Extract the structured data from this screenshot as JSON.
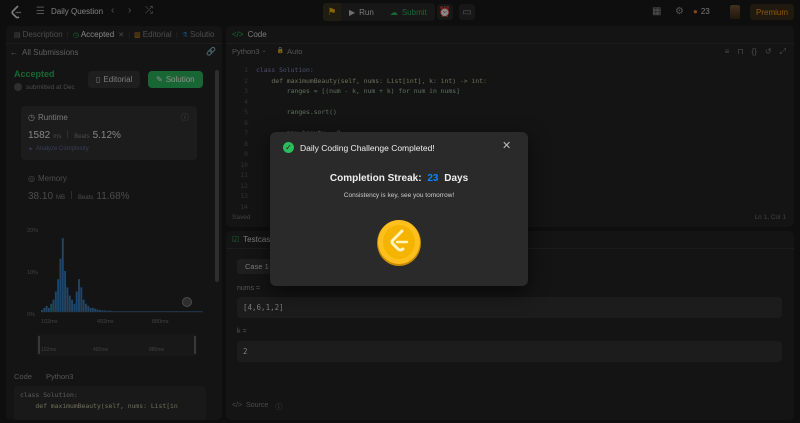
{
  "topbar": {
    "title": "Daily Question",
    "run_label": "Run",
    "submit_label": "Submit",
    "streak_count": "23",
    "premium_label": "Premium"
  },
  "left": {
    "tabs": [
      "Description",
      "Accepted",
      "Editorial",
      "Solutio"
    ],
    "back_label": "All Submissions",
    "status": "Accepted",
    "submitted": "submitted at Dec",
    "editorial_btn": "Editorial",
    "solution_btn": "Solution",
    "runtime": {
      "label": "Runtime",
      "value": "1582",
      "unit": "ms",
      "beats_label": "Beats",
      "beats": "5.12%",
      "analyze": "Analyze Complexity"
    },
    "memory": {
      "label": "Memory",
      "value": "38.10",
      "unit": "MB",
      "beats_label": "Beats",
      "beats": "11.68%"
    },
    "chart_data": {
      "type": "bar",
      "y_ticks": [
        "20%",
        "10%",
        "0%"
      ],
      "x_ticks": [
        "102ms",
        "492ms",
        "880ms"
      ],
      "mini_x_ticks": [
        "102ms",
        "492ms",
        "880ms"
      ],
      "ylim": [
        0,
        20
      ],
      "values": [
        0.5,
        1,
        1.5,
        1,
        2,
        3,
        5,
        8,
        13,
        18,
        10,
        6,
        4,
        3,
        2,
        5,
        8,
        6,
        3,
        2,
        1.5,
        1,
        1,
        0.8,
        0.6,
        0.5,
        0.4,
        0.4,
        0.3,
        0.3,
        0.3,
        0.2,
        0.2,
        0.2,
        0.2,
        0.2,
        0.2,
        0.2,
        0.2,
        0.2,
        0.2,
        0.2,
        0.2,
        0.2,
        0.2,
        0.2,
        0.2,
        0.2,
        0.2,
        0.2,
        0.2,
        0.2,
        0.2,
        0.2,
        0.2,
        0.2,
        0.2,
        0.2,
        0.2,
        0.2,
        0.2,
        0.2,
        0.2,
        0.2,
        0.2,
        0.2,
        0.2,
        0.2,
        0.2,
        0.2
      ]
    },
    "code_label": "Code",
    "lang_label": "Python3",
    "snippet": [
      "class Solution:",
      "    def maximumBeauty(self, nums: List[in"
    ]
  },
  "code": {
    "title": "Code",
    "lang": "Python3",
    "auto": "Auto",
    "lines": [
      "class Solution:",
      "    def maximumBeauty(self, nums: List[int], k: int) -> int:",
      "        ranges = [(num - k, num + k) for num in nums]",
      "",
      "        ranges.sort()",
      "",
      "        max_beauty = 0",
      "",
      "",
      "",
      "",
      "",
      "",
      ""
    ],
    "line_numbers": [
      "1",
      "2",
      "3",
      "4",
      "5",
      "6",
      "7",
      "8",
      "9",
      "10",
      "11",
      "12",
      "13",
      "14"
    ],
    "saved": "Saved",
    "position": "Ln 1, Col 1"
  },
  "testcase": {
    "title": "Testcase",
    "case_label": "Case 1",
    "nums_label": "nums =",
    "nums_value": "[4,6,1,2]",
    "k_label": "k =",
    "k_value": "2",
    "source_label": "Source"
  },
  "modal": {
    "title": "Daily Coding Challenge Completed!",
    "streak_prefix": "Completion Streak:",
    "streak_num": "23",
    "streak_suffix": "Days",
    "message": "Consistency is key, see you tomorrow!"
  },
  "colors": {
    "accent_green": "#2cbb5d",
    "accent_blue": "#0a84ff",
    "gold": "#ffc01e",
    "bar": "#3a7fbf"
  }
}
